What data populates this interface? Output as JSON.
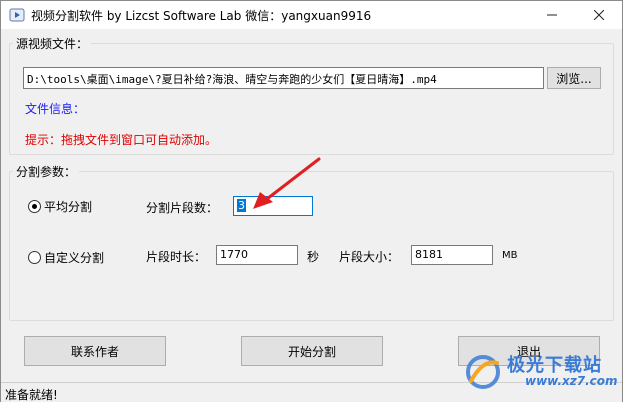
{
  "window": {
    "title": "视频分割软件  by Lizcst Software Lab  微信：yangxuan9916",
    "minimize_icon": "minimize-icon",
    "close_icon": "close-icon"
  },
  "source_group": {
    "legend": "源视频文件：",
    "path_value": "D:\\tools\\桌面\\image\\?夏日补给?海浪、晴空与奔跑的少女们【夏日晴海】.mp4",
    "browse_label": "浏览...",
    "file_info_label": "文件信息：",
    "tip": "提示：拖拽文件到窗口可自动添加。",
    "file_info_color": "#1a1aff",
    "tip_color": "#e00000"
  },
  "split_group": {
    "legend": "分割参数：",
    "radio_average": {
      "label": "平均分割",
      "selected": true
    },
    "radio_custom": {
      "label": "自定义分割",
      "selected": false
    },
    "segment_count_label": "分割片段数：",
    "segment_count_value": "3",
    "segment_length_label": "片段时长：",
    "segment_length_value": "1770",
    "seconds_unit": "秒",
    "segment_size_label": "片段大小：",
    "segment_size_value": "8181",
    "mb_unit": "MB"
  },
  "buttons": {
    "contact": "联系作者",
    "start": "开始分割",
    "exit": "退出"
  },
  "status": {
    "text": "准备就绪!"
  },
  "watermark": {
    "brand": "极光下载站",
    "url": "www.xz7.com",
    "color": "#3a7bd5"
  },
  "annotation": {
    "arrow_color": "#e02020"
  }
}
